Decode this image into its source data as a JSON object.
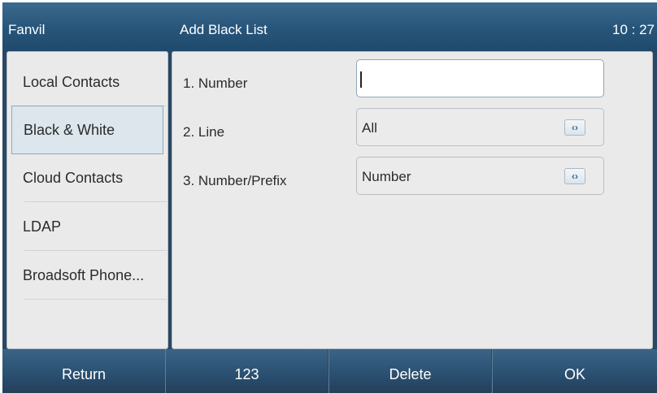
{
  "status_bar": {
    "brand": "Fanvil",
    "title": "Add Black List",
    "time": "10 : 27"
  },
  "sidebar": {
    "items": [
      {
        "label": "Local Contacts",
        "active": false
      },
      {
        "label": "Black & White",
        "active": true
      },
      {
        "label": "Cloud Contacts",
        "active": false
      },
      {
        "label": "LDAP",
        "active": false
      },
      {
        "label": "Broadsoft Phone...",
        "active": false
      }
    ]
  },
  "form": {
    "fields": [
      {
        "label": "1. Number",
        "value": "",
        "type": "text-input"
      },
      {
        "label": "2. Line",
        "value": "All",
        "type": "selector",
        "selector_icon": "left-right-arrows-icon"
      },
      {
        "label": "3. Number/Prefix",
        "value": "Number",
        "type": "selector",
        "selector_icon": "left-right-arrows-icon"
      }
    ]
  },
  "softkeys": [
    {
      "label": "Return"
    },
    {
      "label": "123"
    },
    {
      "label": "Delete"
    },
    {
      "label": "OK"
    }
  ],
  "colors": {
    "header": "#27557a",
    "softkey": "#2a4f70",
    "panel": "#eaeaea",
    "active_item": "#dce6ec"
  }
}
